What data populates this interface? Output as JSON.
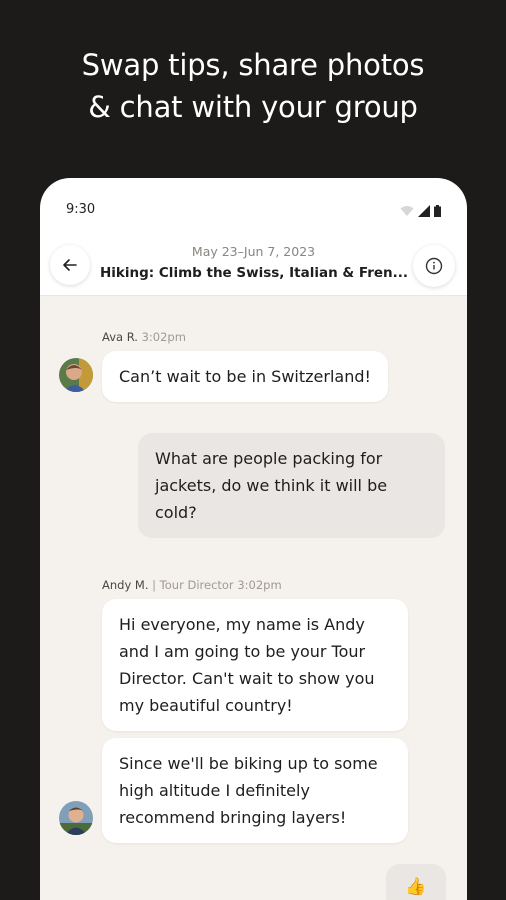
{
  "promo": {
    "line1": "Swap tips, share photos",
    "line2": "& chat with your group"
  },
  "status": {
    "time": "9:30"
  },
  "header": {
    "dates": "May 23–Jun 7, 2023",
    "trip_title": "Hiking: Climb the Swiss, Italian & Fren..."
  },
  "messages": [
    {
      "sender": "Ava R.",
      "time": "3:02pm",
      "text": "Can’t wait to be in Switzerland!"
    },
    {
      "sender": "me",
      "lines": [
        "What are people packing for",
        "jackets, do we think it will be",
        "cold?"
      ]
    },
    {
      "sender": "Andy M.",
      "role": "| Tour Director",
      "time": "3:02pm",
      "lines": [
        "Hi everyone, my name is Andy",
        "and I am going to be your Tour",
        "Director. Can't wait to show you",
        "my beautiful country!"
      ]
    },
    {
      "sender": "Andy M.",
      "lines": [
        "Since we'll be biking up to some",
        "high altitude I definitely",
        "recommend bringing layers!"
      ]
    },
    {
      "sender": "me",
      "text": "👍"
    }
  ],
  "icons": {
    "back": "arrow-left-icon",
    "info": "info-icon",
    "wifi": "wifi-icon",
    "signal": "signal-icon",
    "battery": "battery-icon"
  },
  "colors": {
    "background": "#1c1b1a",
    "chat_background": "#f5f1ec",
    "my_bubble": "#e9e6e3",
    "their_bubble": "#ffffff"
  }
}
